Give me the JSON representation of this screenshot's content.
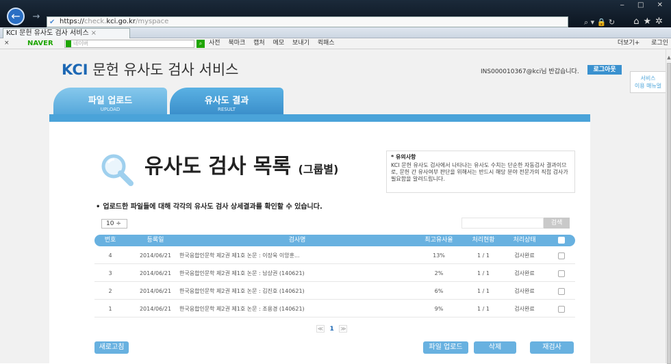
{
  "browser": {
    "url_scheme": "https://",
    "url_sub": "check.",
    "url_domain": "kci.go.kr",
    "url_path": "/myspace",
    "tab_title": "KCI 문헌 유사도 검사 서비스",
    "back_icon": "back-arrow-icon",
    "forward_icon": "forward-arrow-icon"
  },
  "naver_toolbar": {
    "close": "×",
    "brand": "NAVER",
    "search_placeholder": "네이버",
    "items": [
      "사전",
      "북마크",
      "캡처",
      "메모",
      "보내기",
      "퀵패스"
    ],
    "more": "더보기+",
    "login": "로그인"
  },
  "header": {
    "logo_brand": "KCI",
    "logo_text": "문헌 유사도 검사 서비스",
    "login_info": "INS000010367@kci님 반갑습니다.",
    "logout": "로그아웃"
  },
  "tabs": [
    {
      "label": "파일 업로드",
      "sub": "UPLOAD"
    },
    {
      "label": "유사도 결과",
      "sub": "RESULT"
    }
  ],
  "side_tab": {
    "line1": "서비스",
    "line2": "이용 매뉴얼"
  },
  "page_title": {
    "main": "유사도 검사 목록",
    "suffix": "(그룹별)"
  },
  "notice": {
    "title": "* 유의사항",
    "body": "KCI 문헌 유사도 검사에서 나타나는 유사도 수치는 단순한 자동검사 결과이므로, 문헌 간 유사여부 판단을 위해서는 반드시 해당 분야 전문가의 직접 검사가 필요함을 알려드립니다."
  },
  "subtitle": "업로드한 파일들에 대해 각각의 유사도 검사 상세결과를 확인할 수 있습니다.",
  "page_size": "10 ÷",
  "search_button": "검색",
  "table": {
    "headers": {
      "no": "번호",
      "date": "등록일",
      "title": "검사명",
      "similarity": "최고유사율",
      "progress": "처리현황",
      "status": "처리상태"
    },
    "rows": [
      {
        "no": "4",
        "date": "2014/06/21",
        "title": "한국응합인문학 제2권 제1호 논문 : 이장욱 이앙훈...",
        "similarity": "13%",
        "progress": "1 / 1",
        "status": "검사완료"
      },
      {
        "no": "3",
        "date": "2014/06/21",
        "title": "한국응합인문학 제2권 제1호 논문 : 남상권 (140621)",
        "similarity": "2%",
        "progress": "1 / 1",
        "status": "검사완료"
      },
      {
        "no": "2",
        "date": "2014/06/21",
        "title": "한국응합인문학 제2권 제1호 논문 : 김진호 (140621)",
        "similarity": "6%",
        "progress": "1 / 1",
        "status": "검사완료"
      },
      {
        "no": "1",
        "date": "2014/06/21",
        "title": "한국응합인문학 제2권 제1호 논문 : 조용경 (140621)",
        "similarity": "9%",
        "progress": "1 / 1",
        "status": "검사완료"
      }
    ]
  },
  "pagination": {
    "prev": "≪",
    "current": "1",
    "next": "≫"
  },
  "buttons": {
    "refresh": "새로고침",
    "upload": "파일 업로드",
    "delete": "삭제",
    "recheck": "재검사"
  }
}
